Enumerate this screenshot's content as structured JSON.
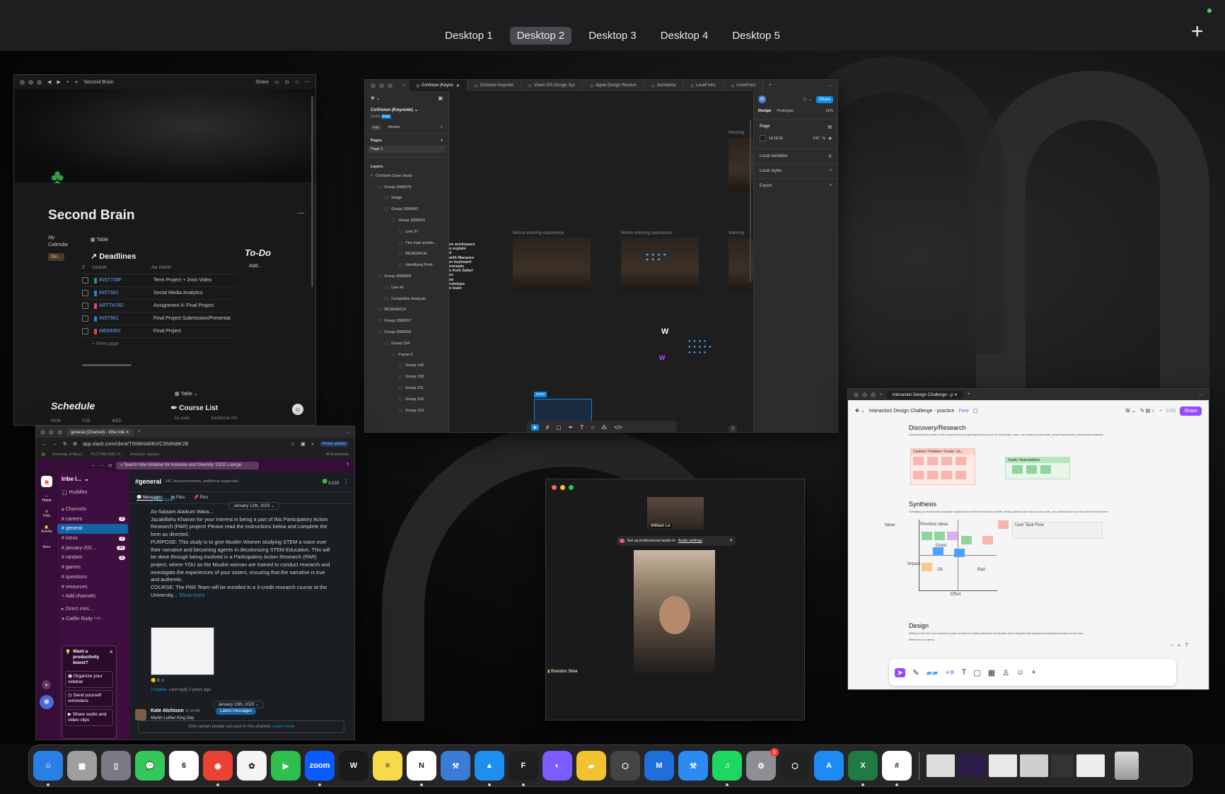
{
  "mission_control": {
    "desktops": [
      "Desktop 1",
      "Desktop 2",
      "Desktop 3",
      "Desktop 4",
      "Desktop 5"
    ],
    "active_desktop": "Desktop 2",
    "add_label": "+"
  },
  "notion": {
    "title": "Second Brain",
    "share": "Share",
    "page_title": "Second Brain",
    "my_calendar": "My Calendar",
    "calendar_chip": "De...",
    "view_table": "Table",
    "deadlines_title": "Deadlines",
    "col_course": "course",
    "col_name": "Aa name",
    "rows": [
      {
        "course": "INST728F",
        "name": "Term Project + 2min Video",
        "color": "#2e9b4e"
      },
      {
        "course": "INST661",
        "name": "Social Media Analytics",
        "color": "#2f7bd6"
      },
      {
        "course": "ARTT479D",
        "name": "Assignment 4: Final Project",
        "color": "#d64a7f"
      },
      {
        "course": "INST661",
        "name": "Final Project Submission/Presentat",
        "color": "#2f7bd6"
      },
      {
        "course": "IMDM350",
        "name": "Final Project",
        "color": "#d84a3a"
      }
    ],
    "new_page": "+ New page",
    "todo_title": "To-Do",
    "todo_add": "Add...",
    "schedule_title": "Schedule",
    "schedule_days": [
      "MON",
      "TUE",
      "WED"
    ],
    "table2": "Table",
    "course_list": "Course List",
    "col_code": "Aa code",
    "col_info": "Additional Info"
  },
  "figma": {
    "tabs": [
      "CoVision (Keyno",
      "CoVision Keynote",
      "Vision OS Design Sys",
      "Apple Design Resoun",
      "Gemberta",
      "LoveFrom,",
      "LoveFrom"
    ],
    "file_name": "CoVision (Keynote)",
    "drafts": "Drafts",
    "free": "Free",
    "file_tab": "File",
    "assets_tab": "Assets",
    "pages_label": "Pages",
    "page1": "Page 1",
    "layers_label": "Layers",
    "layers": [
      {
        "name": "CoVision Case Study",
        "indent": 0
      },
      {
        "name": "Group 2686675",
        "indent": 1
      },
      {
        "name": "Image",
        "indent": 2
      },
      {
        "name": "Group 2686642",
        "indent": 2
      },
      {
        "name": "Group 2686641",
        "indent": 3
      },
      {
        "name": "Line 37",
        "indent": 4
      },
      {
        "name": "The main proble...",
        "indent": 4
      },
      {
        "name": "RESEARCH",
        "indent": 4
      },
      {
        "name": "Identifying Prob...",
        "indent": 4
      },
      {
        "name": "Group 2686669",
        "indent": 1
      },
      {
        "name": "Line 41",
        "indent": 2
      },
      {
        "name": "Competitor Analysis",
        "indent": 2
      },
      {
        "name": "RESEARCH",
        "indent": 1
      },
      {
        "name": "Group 2686657",
        "indent": 1
      },
      {
        "name": "Group 2686656",
        "indent": 1
      },
      {
        "name": "Group 154",
        "indent": 2
      },
      {
        "name": "Frame 5",
        "indent": 3
      },
      {
        "name": "Group 149",
        "indent": 4
      },
      {
        "name": "Group 158",
        "indent": 4
      },
      {
        "name": "Group 151",
        "indent": 4
      },
      {
        "name": "Group 152",
        "indent": 4
      },
      {
        "name": "Group 153",
        "indent": 4
      }
    ],
    "canvas_labels": [
      "Before entering experience",
      "Before entering experience",
      "Warning",
      "Warning"
    ],
    "canvas_text": [
      "ne workspace",
      "o explain",
      "d",
      "with Marques",
      "or keyboard",
      "oncepts",
      "s from Safari",
      "es",
      "an",
      "rototype",
      "o team"
    ],
    "icons_tag": "Icons",
    "share": "Share",
    "design_tab": "Design",
    "prototype_tab": "Prototype",
    "zoom": "11%",
    "page_section": "Page",
    "page_color": "1E1E1E",
    "page_opacity": "100",
    "percent": "%",
    "local_variables": "Local variables",
    "local_styles": "Local styles",
    "export": "Export",
    "help": "?"
  },
  "slack": {
    "tab_title": "general (Channel) - Iribe Initi",
    "url": "app.slack.com/client/TSN6NAR8V/CSN6N8K2B",
    "finish_update": "Finish update",
    "bookmarks": [
      "University of Maryl...",
      "PLCY380-0101: H...",
      "eFoundry: Xperien..."
    ],
    "all_bookmarks": "All Bookmarks",
    "search": "Search Iribe Initiative for Inclusion and Diversity: DICE Lounge",
    "workspace": "Iribe I...",
    "huddles": "Huddles",
    "channels_label": "Channels",
    "channels": [
      {
        "name": "careers",
        "badge": "9"
      },
      {
        "name": "general",
        "badge": ""
      },
      {
        "name": "intros",
        "badge": "2"
      },
      {
        "name": "january-202...",
        "badge": "84"
      },
      {
        "name": "random",
        "badge": "6"
      },
      {
        "name": "games",
        "badge": ""
      },
      {
        "name": "questions",
        "badge": ""
      },
      {
        "name": "resources",
        "badge": ""
      }
    ],
    "add_channels": "+ Add channels",
    "direct_messages": "Direct mes...",
    "dm_user": "Caitlin Rudy",
    "dm_suffix": "invit...",
    "rail": [
      "Home",
      "DMs",
      "Activity",
      "More"
    ],
    "promo_title": "Want a productivity boost?",
    "promo_items": [
      "Organize your sidebar",
      "Send yourself reminders",
      "Share audio and video clips"
    ],
    "channel_name": "#general",
    "channel_desc": "HIC announcements, additional organizati...",
    "member_count": "3,019",
    "tabs": [
      "Messages",
      "Files",
      "Pins"
    ],
    "date1": "January 12th, 2023",
    "msg_top": "[PAR] Team",
    "msg_lines": [
      "As-Salaam Alaikum Wara...",
      "Jazakillahu Khairan for your interest in being a part of this Participatory Action Research (PAR) project! Please read the instructions below and complete the form as directed.",
      "PURPOSE: This study is to give Muslim Women studying STEM a voice over their narrative and becoming agents in decolonizing STEM Education. This will be done through being involved in a Participatory Action Research (PAR) project, where YOU as the Muslim woman are trained to conduct research and investigate the experiences of your sisters, ensuring that the narrative is true and authentic.",
      "COURSE: The PAR Team will be enrolled in a 3-credit research course at the University..."
    ],
    "show_more": "Show more",
    "reaction_count": "3",
    "replies": "2 replies",
    "last_reply": "Last reply 2 years ago",
    "date2": "January 15th, 2023",
    "author": "Kate Atchison",
    "time": "11:34 AM",
    "latest_messages": "Latest messages",
    "msg2": "Martin Luther King Day",
    "restricted": "Only certain people can post in this channel.",
    "learn_more": "Learn more"
  },
  "zoom": {
    "participant1": "William Le",
    "participant2": "Brandon Sklar",
    "banner": "Set up professional audio in",
    "banner_link": "Audio settings"
  },
  "figjam": {
    "tab_title": "Interaction Design Challenge - p",
    "file_title": "Interaction Design Challenge - practice",
    "free": "Free",
    "share": "Share",
    "timer": "0:00",
    "section1": "Discovery/Research",
    "section1_desc": "Understanding the context of the prompt involves recognizing key factors such as the problem, users, user needs and pain points, product requirements, and potential constraints.",
    "card1": "Context / Problem / Goals / Us...",
    "card2": "Goals / Assumptions",
    "section2": "Synthesis",
    "section2_desc": "Translating our research into actionable insights helps me determine what to prioritize, identify potential user tasks and use cases, and understand the user flow before these screens.",
    "matrix_labels": [
      "Effort",
      "Impact",
      "Ideas",
      "Prioritize Ideas",
      "User Task Flow",
      "Good",
      "Bad",
      "Ok"
    ],
    "section3": "Design",
    "section3_desc": "Writing out the view of (in brackets) to guide my initial low fidelity wireframes and visualize how it integrates both physical and physical interactions for the users.",
    "section3_sub": "Wireframes for (clients)",
    "zoom_help": "?"
  },
  "dock": {
    "apps": [
      {
        "name": "Finder",
        "label": "☺",
        "color": "#2a7ee6",
        "running": true
      },
      {
        "name": "Launchpad",
        "label": "▦",
        "color": "#9e9e9e",
        "running": false
      },
      {
        "name": "iPhone Mirroring",
        "label": "▯",
        "color": "#7a7a84",
        "running": false
      },
      {
        "name": "Messages",
        "label": "💬",
        "color": "#34c759",
        "running": false
      },
      {
        "name": "Calendar",
        "label": "6",
        "color": "#ffffff",
        "running": false
      },
      {
        "name": "Chrome",
        "label": "◉",
        "color": "#e94235",
        "running": true
      },
      {
        "name": "Photos",
        "label": "✿",
        "color": "#f4f4f4",
        "running": false
      },
      {
        "name": "FaceTime",
        "label": "▶",
        "color": "#2fbf4f",
        "running": false
      },
      {
        "name": "Zoom",
        "label": "zoom",
        "color": "#0b5cff",
        "running": true
      },
      {
        "name": "Webex",
        "label": "W",
        "color": "#1a1a1a",
        "running": false
      },
      {
        "name": "Notes",
        "label": "≡",
        "color": "#f7d94c",
        "running": false
      },
      {
        "name": "Notion",
        "label": "N",
        "color": "#ffffff",
        "running": true
      },
      {
        "name": "Xcode Instruments",
        "label": "⚒",
        "color": "#3a7bd5",
        "running": false
      },
      {
        "name": "Keynote",
        "label": "▲",
        "color": "#1f8ef1",
        "running": true
      },
      {
        "name": "Figma",
        "label": "F",
        "color": "#1e1e1e",
        "running": true
      },
      {
        "name": "Arc",
        "label": "◐",
        "color": "#7b5cff",
        "running": false
      },
      {
        "name": "Stickies",
        "label": "▰",
        "color": "#f2c230",
        "running": false
      },
      {
        "name": "Unity",
        "label": "⬡",
        "color": "#444444",
        "running": false
      },
      {
        "name": "Mathpix",
        "label": "M",
        "color": "#1e6fd9",
        "running": false
      },
      {
        "name": "Xcode",
        "label": "⚒",
        "color": "#2b8bf0",
        "running": false
      },
      {
        "name": "Spotify",
        "label": "♫",
        "color": "#1ed760",
        "running": true
      },
      {
        "name": "System Settings",
        "label": "⚙",
        "color": "#8e8e93",
        "running": false,
        "badge": "1"
      },
      {
        "name": "Unity Hub",
        "label": "⬡",
        "color": "#222222",
        "running": false
      },
      {
        "name": "App Store",
        "label": "A",
        "color": "#1e8bf5",
        "running": false
      },
      {
        "name": "Excel",
        "label": "X",
        "color": "#1f7a43",
        "running": true
      },
      {
        "name": "Slack",
        "label": "#",
        "color": "#ffffff",
        "running": true
      }
    ],
    "trash": "Trash"
  }
}
